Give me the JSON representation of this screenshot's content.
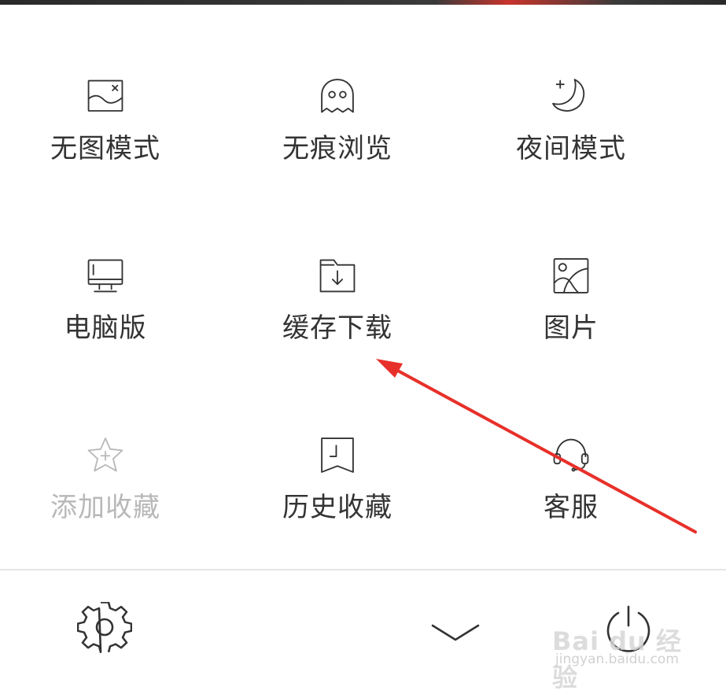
{
  "menu": {
    "items": [
      {
        "label": "无图模式",
        "icon": "no-image-icon",
        "enabled": true
      },
      {
        "label": "无痕浏览",
        "icon": "ghost-icon",
        "enabled": true
      },
      {
        "label": "夜间模式",
        "icon": "moon-icon",
        "enabled": true
      },
      {
        "label": "电脑版",
        "icon": "desktop-icon",
        "enabled": true
      },
      {
        "label": "缓存下载",
        "icon": "download-folder-icon",
        "enabled": true
      },
      {
        "label": "图片",
        "icon": "image-icon",
        "enabled": true
      },
      {
        "label": "添加收藏",
        "icon": "star-add-icon",
        "enabled": false
      },
      {
        "label": "历史收藏",
        "icon": "history-bookmark-icon",
        "enabled": true
      },
      {
        "label": "客服",
        "icon": "headset-icon",
        "enabled": true
      }
    ]
  },
  "bottom_bar": {
    "settings_icon": "gear-icon",
    "collapse_icon": "chevron-down-icon",
    "exit_icon": "power-icon"
  },
  "watermark": {
    "top": "Bai du 经验",
    "bottom": "jingyan.baidu.com"
  },
  "colors": {
    "text": "#333333",
    "disabled_text": "#b8b8b8",
    "icon_stroke": "#333333",
    "annotation_arrow": "#e8302a"
  }
}
